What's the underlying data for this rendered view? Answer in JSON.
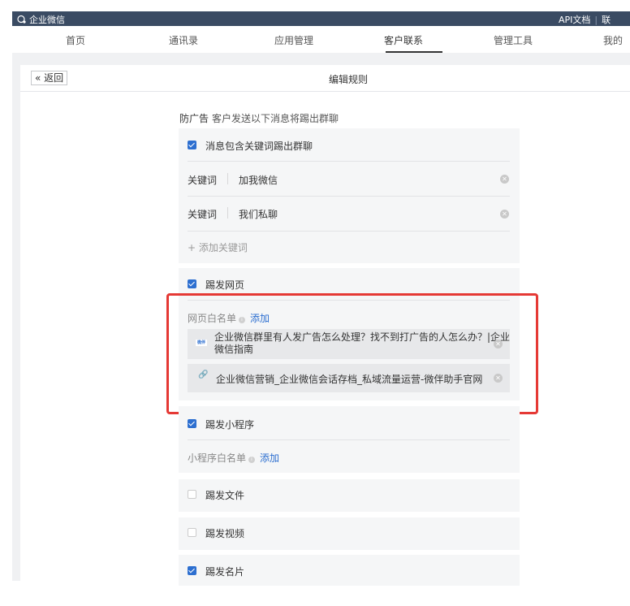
{
  "topbar": {
    "brand": "企业微信",
    "api_doc": "API文档",
    "separator": "|",
    "contact": "联"
  },
  "nav": {
    "tabs": [
      "首页",
      "通讯录",
      "应用管理",
      "客户联系",
      "管理工具",
      "我的"
    ],
    "active": "客户联系"
  },
  "panel": {
    "back_label": "« 返回",
    "title": "编辑规则"
  },
  "rule": {
    "name": "防广告",
    "description": "客户发送以下消息将踢出群聊"
  },
  "keywords": {
    "option_label": "消息包含关键词踢出群聊",
    "checked": true,
    "items": [
      {
        "label": "关键词",
        "value": "加我微信"
      },
      {
        "label": "关键词",
        "value": "我们私聊"
      }
    ],
    "add_label": "+ 添加关键词"
  },
  "webpage": {
    "option_label": "踢发网页",
    "checked": true,
    "whitelist_label": "网页白名单",
    "add_label": "添加",
    "items": [
      {
        "icon": "site-favicon",
        "favicon_text": "微伴",
        "title_line1": "企业微信群里有人发广告怎么处理？找不到打广告的人怎么办？|企业",
        "title_line2": "微信指南"
      },
      {
        "icon": "link-icon",
        "title_line1": "企业微信营销_企业微信会话存档_私域流量运营-微伴助手官网"
      }
    ]
  },
  "miniprogram": {
    "option_label": "踢发小程序",
    "checked": true,
    "whitelist_label": "小程序白名单",
    "add_label": "添加"
  },
  "file": {
    "option_label": "踢发文件",
    "checked": false
  },
  "video": {
    "option_label": "踢发视频",
    "checked": false
  },
  "card": {
    "option_label": "踢发名片",
    "checked": true
  },
  "colors": {
    "topbar": "#3a4b63",
    "accent": "#2d6fd0",
    "highlight": "#e53935",
    "panel_bg": "#f0f1f3"
  }
}
